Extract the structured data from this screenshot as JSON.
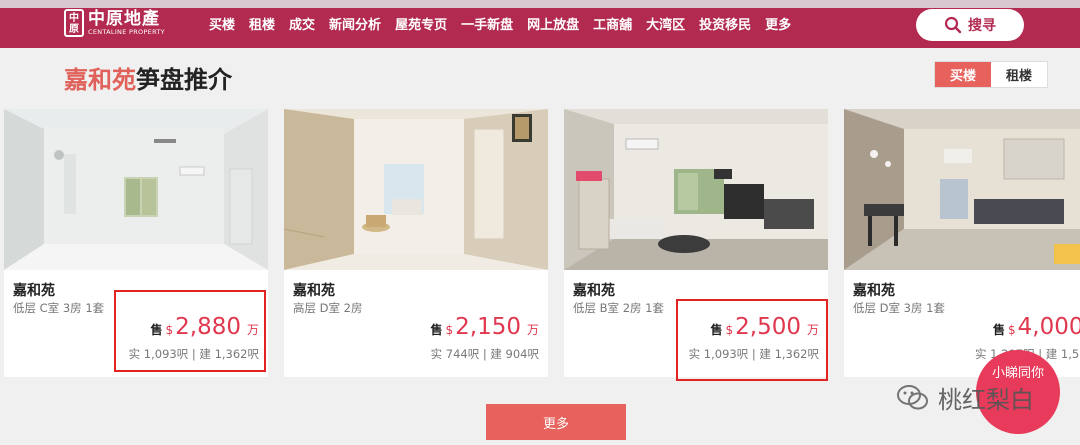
{
  "header": {
    "logo_cn": "中原地產",
    "logo_en": "CENTALINE PROPERTY",
    "nav": [
      "买楼",
      "租楼",
      "成交",
      "新闻分析",
      "屋苑专页",
      "一手新盘",
      "网上放盘",
      "工商舖",
      "大湾区",
      "投资移民",
      "更多"
    ],
    "search_label": "搜寻"
  },
  "section": {
    "title_highlight": "嘉和苑",
    "title_rest": "笋盘推介",
    "toggle_buy": "买楼",
    "toggle_rent": "租楼"
  },
  "cards": [
    {
      "estate": "嘉和苑",
      "detail": "低层 C室 3房 1套",
      "sale_label": "售",
      "currency": "$",
      "price": "2,880",
      "unit": "万",
      "area": "实 1,093呎 | 建 1,362呎"
    },
    {
      "estate": "嘉和苑",
      "detail": "高层 D室 2房",
      "sale_label": "售",
      "currency": "$",
      "price": "2,150",
      "unit": "万",
      "area": "实 744呎 | 建 904呎"
    },
    {
      "estate": "嘉和苑",
      "detail": "低层 B室 2房 1套",
      "sale_label": "售",
      "currency": "$",
      "price": "2,500",
      "unit": "万",
      "area": "实 1,093呎 | 建 1,362呎"
    },
    {
      "estate": "嘉和苑",
      "detail": "低层 D室 3房 1套",
      "sale_label": "售",
      "currency": "$",
      "price": "4,000",
      "unit": "",
      "area": "实 1,297呎 | 建 1,55"
    }
  ],
  "more_label": "更多",
  "badge_text": "小睇同你",
  "watermark": "桃红梨白",
  "colors": {
    "brand": "#b22a50",
    "accent": "#e7625c",
    "price": "#e0384e",
    "highlight_box": "#e32222"
  }
}
